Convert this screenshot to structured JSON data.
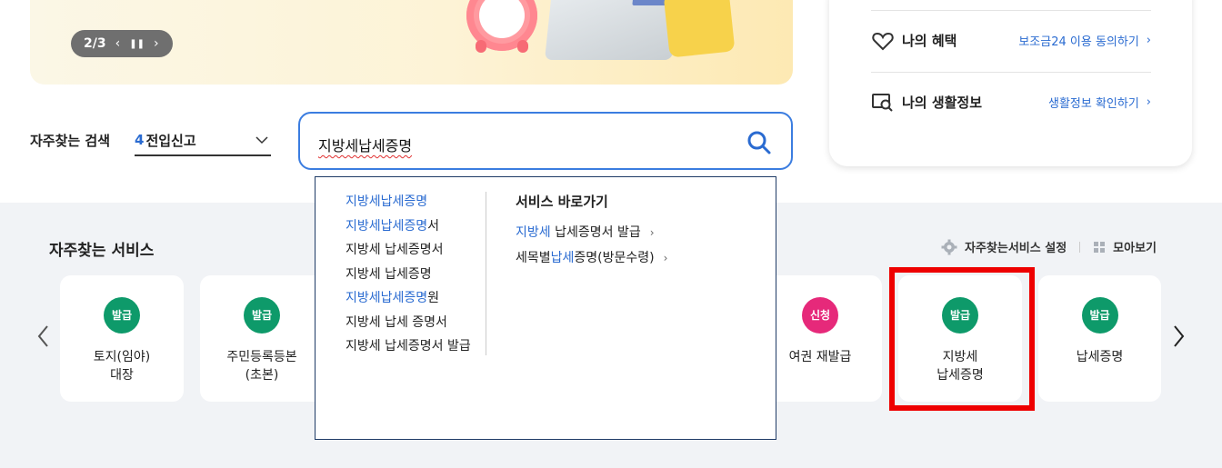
{
  "banner": {
    "pager": {
      "current": "2/3",
      "prev": "‹",
      "pause": "⏸",
      "next": "›"
    }
  },
  "right_panel": {
    "rows": [
      {
        "title": "나의 혜택",
        "link": "보조금24 이용 동의하기",
        "icon": "heart-icon"
      },
      {
        "title": "나의 생활정보",
        "link": "생활정보 확인하기",
        "icon": "screen-search-icon"
      }
    ]
  },
  "search": {
    "label": "자주찾는 검색",
    "keyword_rank": "4",
    "keyword": "전입신고",
    "query": "지방세납세증명"
  },
  "autocomplete": {
    "suggestions": [
      {
        "hl": "지방세납세증명",
        "rest": ""
      },
      {
        "hl": "지방세납세증명",
        "rest": "서"
      },
      {
        "hl": "",
        "rest": "지방세 납세증명서"
      },
      {
        "hl": "",
        "rest": "지방세 납세증명"
      },
      {
        "hl": "지방세납세증명",
        "rest": "원"
      },
      {
        "hl": "",
        "rest": "지방세 납세 증명서"
      },
      {
        "hl": "",
        "rest": "지방세 납세증명서 발급"
      }
    ],
    "shortcut_title": "서비스 바로가기",
    "shortcuts": [
      {
        "pre": "",
        "hl": "지방세",
        "post": " 납세증명서 발급"
      },
      {
        "pre": "세목별",
        "hl": "납세",
        "post": "증명(방문수령)"
      }
    ]
  },
  "services": {
    "title": "자주찾는 서비스",
    "settings_label": "자주찾는서비스 설정",
    "viewall_label": "모아보기",
    "cards": [
      {
        "badge": "발급",
        "label": "토지(임야)\n대장",
        "color": "#0e9a6a"
      },
      {
        "badge": "발급",
        "label": "주민등록등본\n(초본)",
        "color": "#0e9a6a"
      },
      {
        "badge": "신청",
        "label": "여권 재발급",
        "color": "#e6297a"
      },
      {
        "badge": "발급",
        "label": "지방세\n납세증명",
        "color": "#0e9a6a"
      },
      {
        "badge": "발급",
        "label": "납세증명",
        "color": "#0e9a6a"
      }
    ]
  }
}
